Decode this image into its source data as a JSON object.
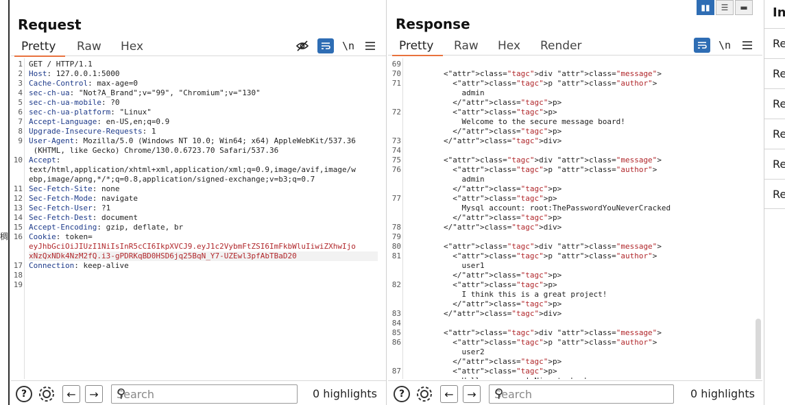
{
  "request": {
    "title": "Request",
    "tabs": [
      "Pretty",
      "Raw",
      "Hex"
    ],
    "active_tab": "Pretty",
    "newline_label": "\\n",
    "lines": [
      {
        "n": "1",
        "text": "GET / HTTP/1.1"
      },
      {
        "n": "2",
        "text": "Host: 127.0.0.1:5000"
      },
      {
        "n": "3",
        "text": "Cache-Control: max-age=0"
      },
      {
        "n": "4",
        "text": "sec-ch-ua: \"Not?A_Brand\";v=\"99\", \"Chromium\";v=\"130\""
      },
      {
        "n": "5",
        "text": "sec-ch-ua-mobile: ?0"
      },
      {
        "n": "6",
        "text": "sec-ch-ua-platform: \"Linux\""
      },
      {
        "n": "7",
        "text": "Accept-Language: en-US,en;q=0.9"
      },
      {
        "n": "8",
        "text": "Upgrade-Insecure-Requests: 1"
      },
      {
        "n": "9",
        "text": "User-Agent: Mozilla/5.0 (Windows NT 10.0; Win64; x64) AppleWebKit/537.36"
      },
      {
        "n": "",
        "text": " (KHTML, like Gecko) Chrome/130.0.6723.70 Safari/537.36"
      },
      {
        "n": "10",
        "text": "Accept:"
      },
      {
        "n": "",
        "text": "text/html,application/xhtml+xml,application/xml;q=0.9,image/avif,image/w"
      },
      {
        "n": "",
        "text": "ebp,image/apng,*/*;q=0.8,application/signed-exchange;v=b3;q=0.7"
      },
      {
        "n": "11",
        "text": "Sec-Fetch-Site: none"
      },
      {
        "n": "12",
        "text": "Sec-Fetch-Mode: navigate"
      },
      {
        "n": "13",
        "text": "Sec-Fetch-User: ?1"
      },
      {
        "n": "14",
        "text": "Sec-Fetch-Dest: document"
      },
      {
        "n": "15",
        "text": "Accept-Encoding: gzip, deflate, br"
      },
      {
        "n": "16",
        "text": "Cookie: token="
      },
      {
        "n": "",
        "text": "eyJhbGciOiJIUzI1NiIsInR5cCI6IkpXVCJ9.eyJ1c2VybmFtZSI6ImFkbWluIiwiZXhwIjo"
      },
      {
        "n": "",
        "text": "xNzQxNDk4NzM2fQ.i3-gPDRKqBD0HSD6jq25BqN_Y7-UZEwl3pfAbTBaD20"
      },
      {
        "n": "17",
        "text": "Connection: keep-alive"
      },
      {
        "n": "18",
        "text": ""
      },
      {
        "n": "19",
        "text": ""
      }
    ],
    "search_placeholder": "Search",
    "highlights": "0 highlights"
  },
  "response": {
    "title": "Response",
    "tabs": [
      "Pretty",
      "Raw",
      "Hex",
      "Render"
    ],
    "active_tab": "Pretty",
    "newline_label": "\\n",
    "lines": [
      {
        "n": "69",
        "text": ""
      },
      {
        "n": "70",
        "text": "        <div class=\"message\">"
      },
      {
        "n": "71",
        "text": "          <p class=\"author\">"
      },
      {
        "n": "",
        "text": "            admin"
      },
      {
        "n": "",
        "text": "          </p>"
      },
      {
        "n": "72",
        "text": "          <p>"
      },
      {
        "n": "",
        "text": "            Welcome to the secure message board!"
      },
      {
        "n": "",
        "text": "          </p>"
      },
      {
        "n": "73",
        "text": "        </div>"
      },
      {
        "n": "74",
        "text": ""
      },
      {
        "n": "75",
        "text": "        <div class=\"message\">"
      },
      {
        "n": "76",
        "text": "          <p class=\"author\">"
      },
      {
        "n": "",
        "text": "            admin"
      },
      {
        "n": "",
        "text": "          </p>"
      },
      {
        "n": "77",
        "text": "          <p>"
      },
      {
        "n": "",
        "text": "            Mysql account: root:ThePasswordYouNeverCracked"
      },
      {
        "n": "",
        "text": "          </p>"
      },
      {
        "n": "78",
        "text": "        </div>"
      },
      {
        "n": "79",
        "text": ""
      },
      {
        "n": "80",
        "text": "        <div class=\"message\">"
      },
      {
        "n": "81",
        "text": "          <p class=\"author\">"
      },
      {
        "n": "",
        "text": "            user1"
      },
      {
        "n": "",
        "text": "          </p>"
      },
      {
        "n": "82",
        "text": "          <p>"
      },
      {
        "n": "",
        "text": "            I think this is a great project!"
      },
      {
        "n": "",
        "text": "          </p>"
      },
      {
        "n": "83",
        "text": "        </div>"
      },
      {
        "n": "84",
        "text": ""
      },
      {
        "n": "85",
        "text": "        <div class=\"message\">"
      },
      {
        "n": "86",
        "text": "          <p class=\"author\">"
      },
      {
        "n": "",
        "text": "            user2"
      },
      {
        "n": "",
        "text": "          </p>"
      },
      {
        "n": "87",
        "text": "          <p>"
      },
      {
        "n": "",
        "text": "            Hello everyone! Nice to be here"
      }
    ],
    "search_placeholder": "Search",
    "highlights": "0 highlights"
  },
  "inspector": {
    "title": "In",
    "rows": [
      "Re",
      "Re",
      "Re",
      "Re",
      "Re",
      "Re"
    ]
  },
  "left_edge_glyph": "稠",
  "colors": {
    "accent": "#e8713c",
    "active_button": "#2e6db4",
    "string_red": "#b0262a",
    "key_blue": "#1d3a8a"
  }
}
